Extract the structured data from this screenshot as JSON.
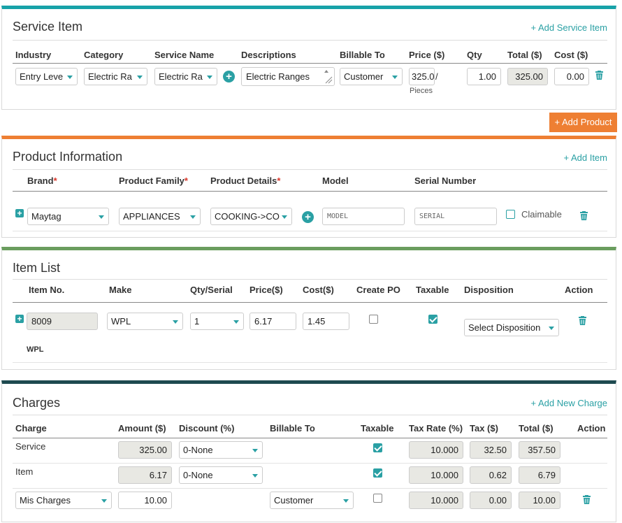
{
  "service": {
    "title": "Service Item",
    "add_link": "+ Add Service Item",
    "accent": "#17a2a8",
    "headers": [
      "Industry",
      "Category",
      "Service Name",
      "Descriptions",
      "Billable To",
      "Price ($)",
      "Qty",
      "Total ($)",
      "Cost ($)"
    ],
    "row": {
      "industry": "Entry Leve",
      "category": "Electric Ra",
      "service_name": "Electric Ra",
      "description": "Electric Ranges",
      "billable_to": "Customer",
      "price": "325.0",
      "price_unit": "/",
      "unit_label": "Pieces",
      "qty": "1.00",
      "total": "325.00",
      "cost": "0.00"
    }
  },
  "add_product_button": "+ Add Product",
  "product": {
    "title": "Product Information",
    "add_link": "+ Add Item",
    "accent": "#ee7f33",
    "headers": [
      "Brand",
      "Product Family",
      "Product Details",
      "Model",
      "Serial Number"
    ],
    "required_mark": "*",
    "row": {
      "brand": "Maytag",
      "family": "APPLIANCES",
      "details": "COOKING->CO",
      "model_placeholder": "MODEL",
      "serial_placeholder": "SERIAL",
      "claimable_label": "Claimable"
    }
  },
  "items": {
    "title": "Item List",
    "accent": "#6a9d5e",
    "headers": [
      "Item No.",
      "Make",
      "Qty/Serial",
      "Price($)",
      "Cost($)",
      "Create PO",
      "Taxable",
      "Disposition",
      "Action"
    ],
    "row": {
      "item_no": "8009",
      "make": "WPL",
      "qty": "1",
      "price": "6.17",
      "cost": "1.45",
      "create_po": false,
      "taxable": true,
      "disposition": "Select Disposition",
      "make_sub": "WPL"
    }
  },
  "charges": {
    "title": "Charges",
    "add_link": "+ Add New Charge",
    "accent": "#1e4a50",
    "headers": [
      "Charge",
      "Amount ($)",
      "Discount (%)",
      "Billable To",
      "Taxable",
      "Tax Rate (%)",
      "Tax ($)",
      "Total ($)",
      "Action"
    ],
    "rows": [
      {
        "charge": "Service",
        "amount": "325.00",
        "discount": "0-None",
        "billable_to": "",
        "taxable": true,
        "tax_rate": "10.000",
        "tax": "32.50",
        "total": "357.50"
      },
      {
        "charge": "Item",
        "amount": "6.17",
        "discount": "0-None",
        "billable_to": "",
        "taxable": true,
        "tax_rate": "10.000",
        "tax": "0.62",
        "total": "6.79"
      },
      {
        "charge": "Mis Charges",
        "amount": "10.00",
        "discount": "",
        "billable_to": "Customer",
        "taxable": false,
        "tax_rate": "10.000",
        "tax": "0.00",
        "total": "10.00"
      }
    ]
  }
}
